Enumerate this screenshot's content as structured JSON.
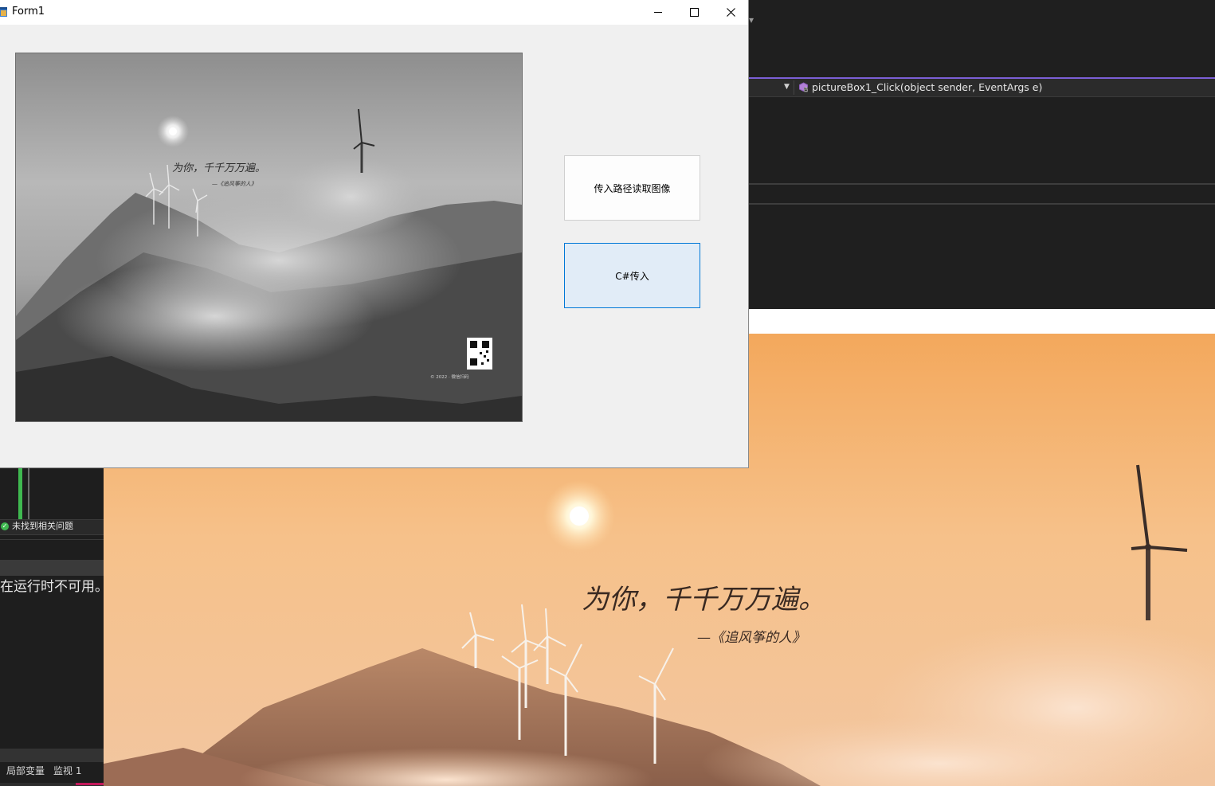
{
  "form": {
    "title": "Form1",
    "buttons": {
      "read_path": "传入路径读取图像",
      "csharp": "C#传入"
    },
    "picture": {
      "quote": "为你，千千万万遍。",
      "attribution": "—《追风筝的人》",
      "footer": "© 2022 · 微信扫码"
    }
  },
  "ide": {
    "navigation_method": "pictureBox1_Click(object sender, EventArgs e)",
    "issues_status": "未找到相关问题",
    "runtime_message": "在运行时不可用。",
    "bottom_tabs": [
      "局部变量",
      "监视 1"
    ]
  },
  "large_photo": {
    "quote": "为你，千千万万遍。",
    "attribution": "—《追风筝的人》"
  },
  "colors": {
    "ide_background": "#1f1f1f",
    "ide_accent": "#7b5fd6",
    "form_background": "#f0f0f0",
    "button_focus_border": "#0078d7",
    "button_focus_fill": "#e1ecf7",
    "status_ok": "#3fb950"
  }
}
